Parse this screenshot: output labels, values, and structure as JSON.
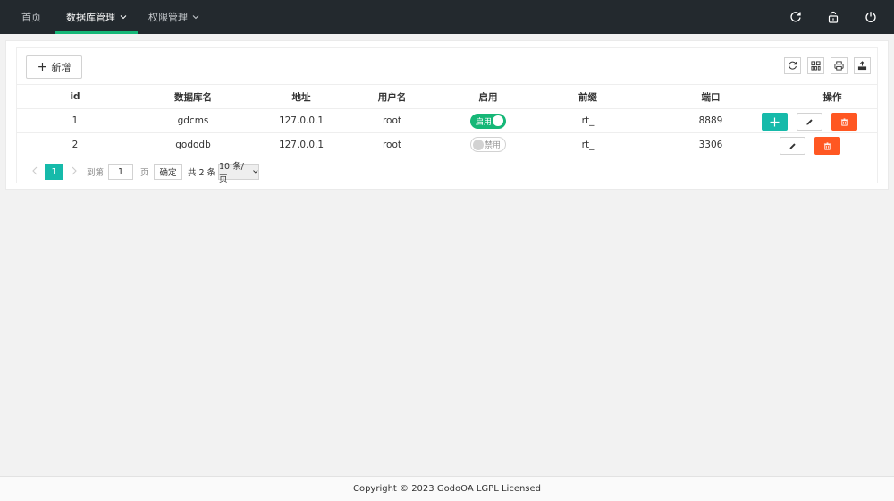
{
  "nav": {
    "items": [
      {
        "label": "首页"
      },
      {
        "label": "数据库管理"
      },
      {
        "label": "权限管理"
      }
    ]
  },
  "toolbar": {
    "add_label": "新增"
  },
  "table": {
    "headers": [
      "id",
      "数据库名",
      "地址",
      "用户名",
      "启用",
      "前缀",
      "端口",
      "操作"
    ],
    "rows": [
      {
        "id": "1",
        "name": "gdcms",
        "host": "127.0.0.1",
        "user": "root",
        "enabled": "启用",
        "enabled_state": "on",
        "prefix": "rt_",
        "port": "8889"
      },
      {
        "id": "2",
        "name": "gododb",
        "host": "127.0.0.1",
        "user": "root",
        "enabled": "禁用",
        "enabled_state": "off",
        "prefix": "rt_",
        "port": "3306"
      }
    ]
  },
  "pager": {
    "current": "1",
    "goto_label": "到第",
    "goto_value": "1",
    "page_label": "页",
    "confirm_label": "确定",
    "total_label": "共 2 条",
    "limit_label": "10 条/页"
  },
  "footer": {
    "text": "Copyright © 2023 GodoOA LGPL Licensed"
  },
  "colors": {
    "nav_bg": "#23292e",
    "accent_green": "#16b777",
    "teal": "#16baaa",
    "danger": "#ff5722"
  }
}
